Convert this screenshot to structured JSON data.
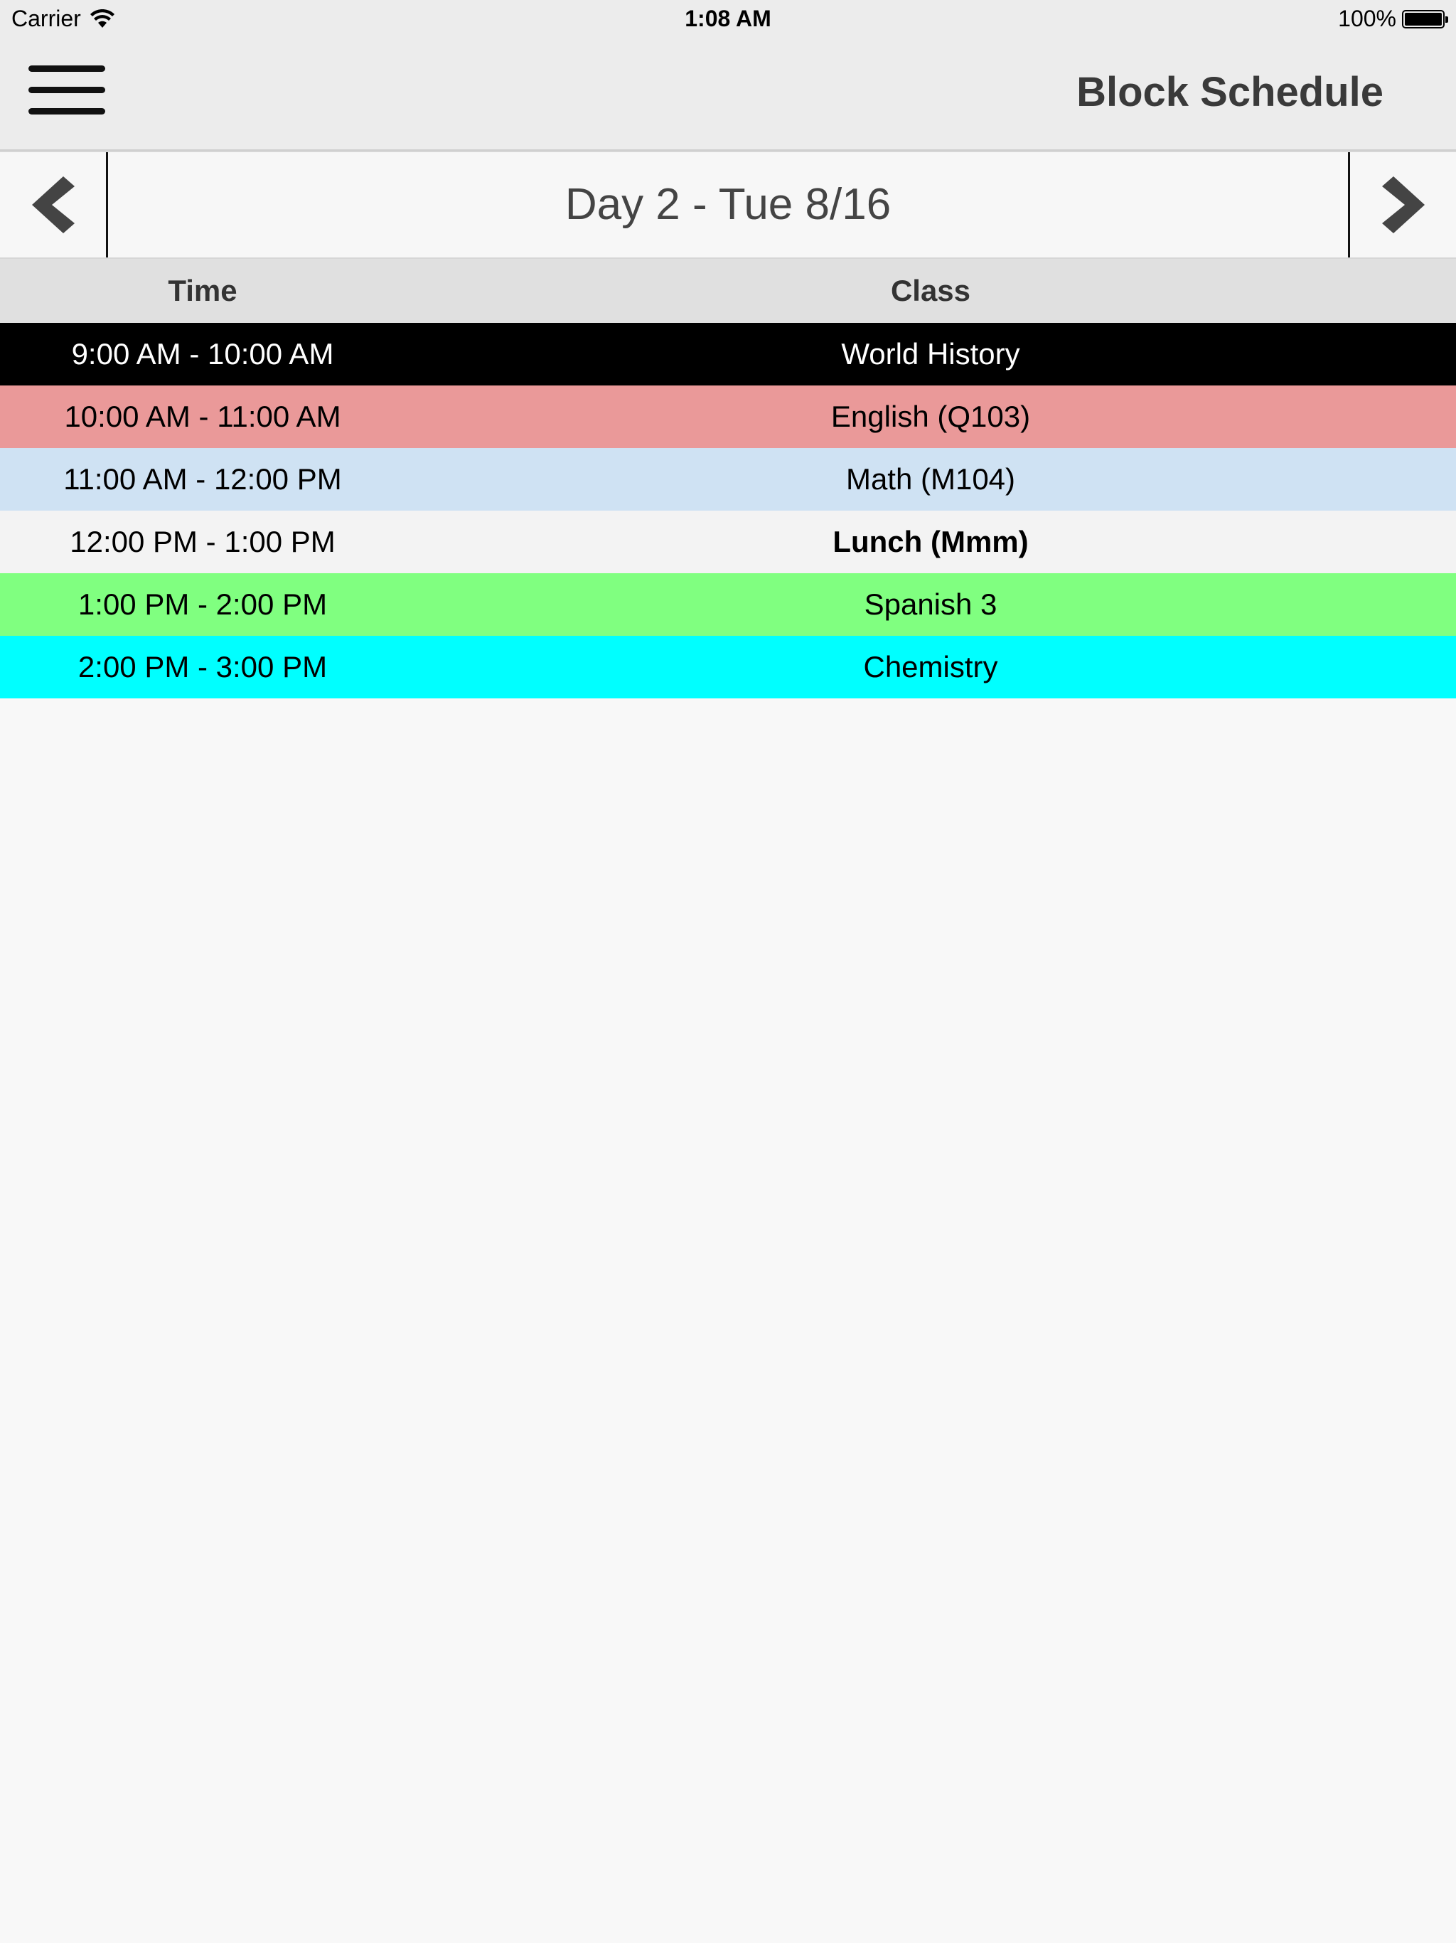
{
  "status_bar": {
    "carrier": "Carrier",
    "time": "1:08 AM",
    "battery": "100%"
  },
  "nav": {
    "title": "Block Schedule",
    "menu_icon": "hamburger-menu-icon"
  },
  "day_nav": {
    "label": "Day 2 - Tue 8/16",
    "prev_icon": "chevron-left-icon",
    "next_icon": "chevron-right-icon"
  },
  "schedule": {
    "headers": {
      "time": "Time",
      "class": "Class"
    },
    "rows": [
      {
        "time": "9:00 AM - 10:00 AM",
        "class": "World History",
        "bg": "#000000",
        "fg": "#ffffff",
        "bold": false
      },
      {
        "time": "10:00 AM - 11:00 AM",
        "class": "English (Q103)",
        "bg": "#ea9999",
        "fg": "#000000",
        "bold": false
      },
      {
        "time": "11:00 AM - 12:00 PM",
        "class": "Math (M104)",
        "bg": "#cfe2f3",
        "fg": "#000000",
        "bold": false
      },
      {
        "time": "12:00 PM - 1:00 PM",
        "class": "Lunch (Mmm)",
        "bg": "#f3f3f3",
        "fg": "#000000",
        "bold": true
      },
      {
        "time": "1:00 PM - 2:00 PM",
        "class": "Spanish 3",
        "bg": "#80ff80",
        "fg": "#000000",
        "bold": false
      },
      {
        "time": "2:00 PM - 3:00 PM",
        "class": "Chemistry",
        "bg": "#00ffff",
        "fg": "#000000",
        "bold": false
      }
    ]
  }
}
